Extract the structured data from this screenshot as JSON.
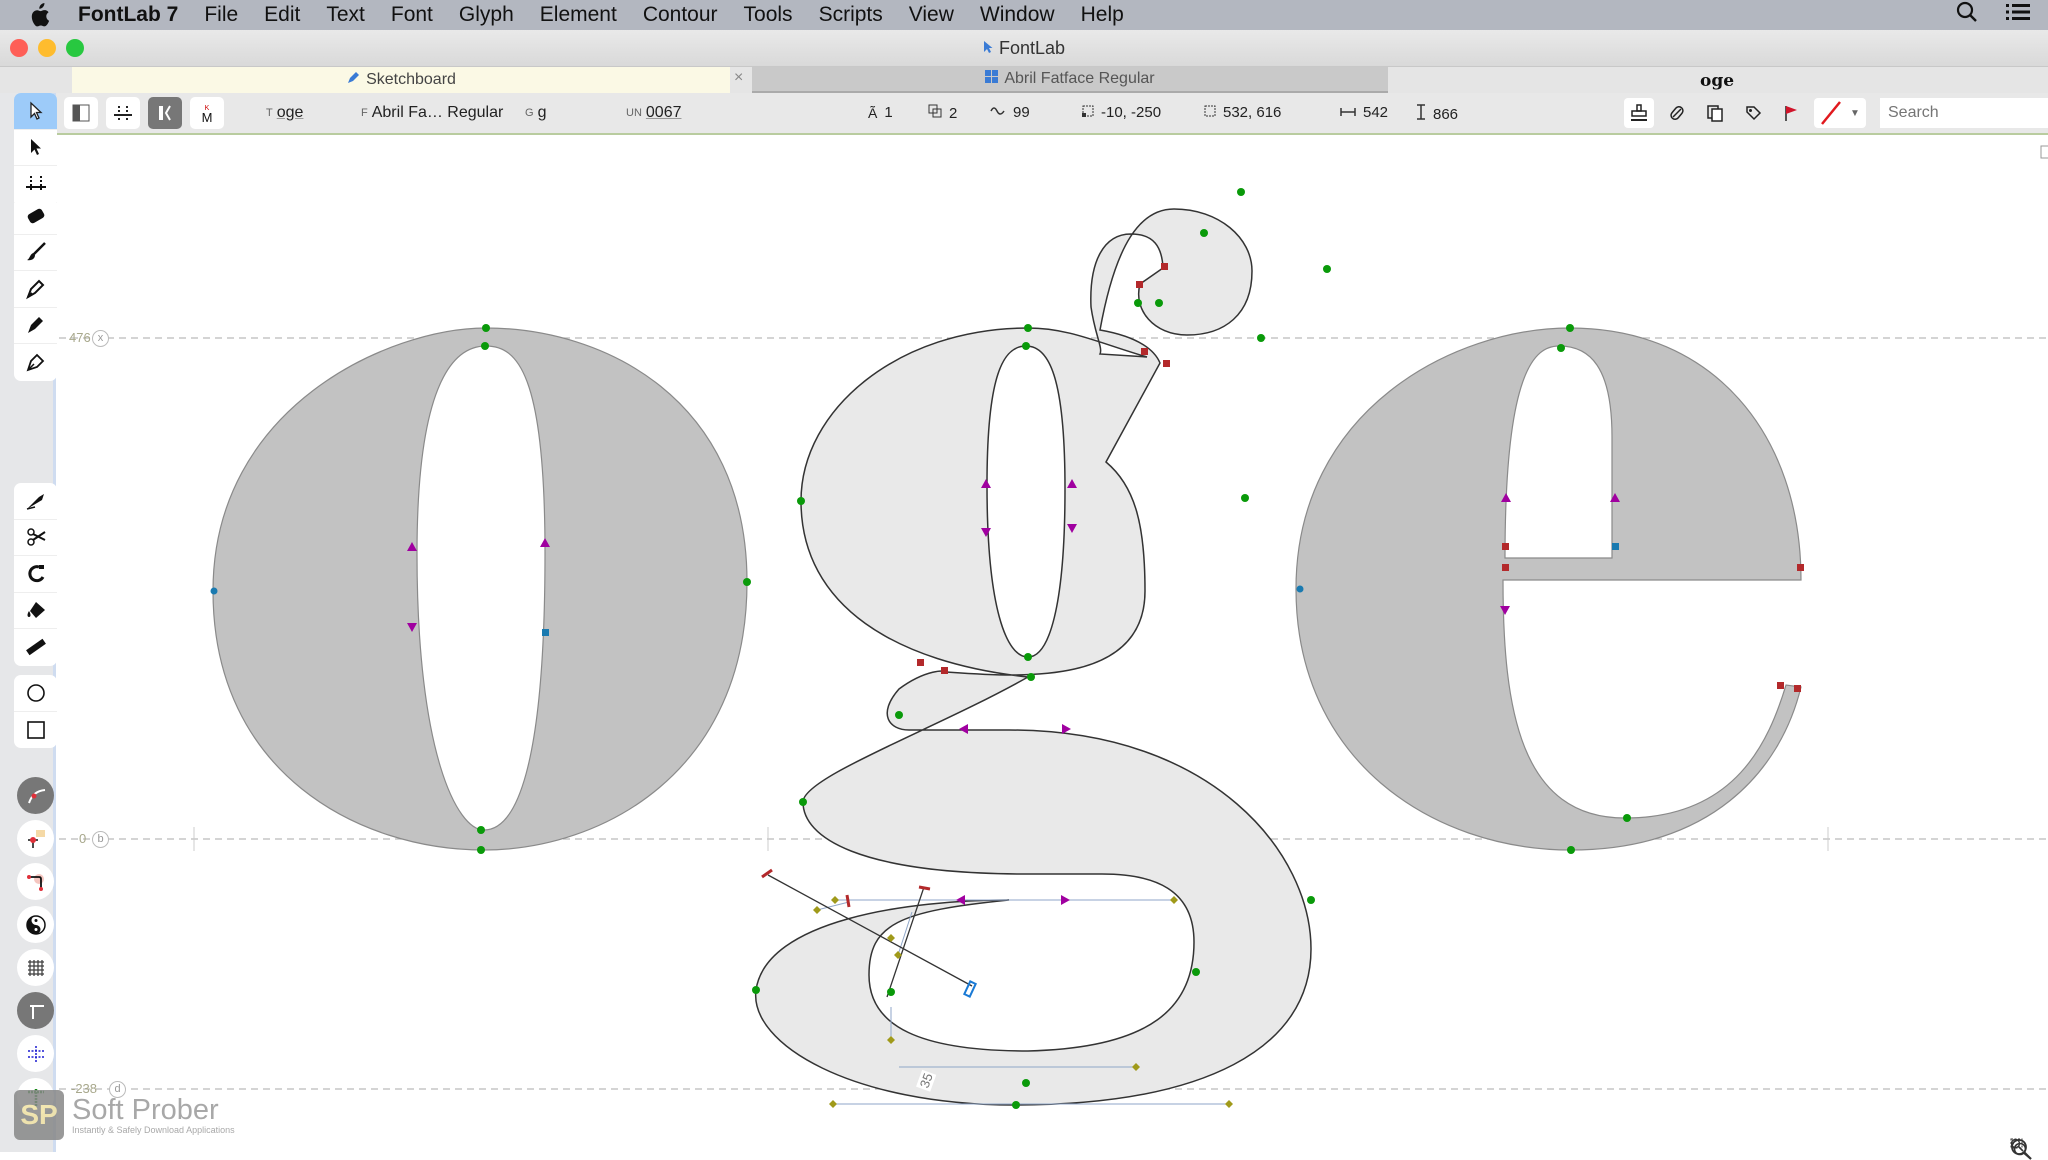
{
  "menubar": {
    "app_name": "FontLab 7",
    "items": [
      "File",
      "Edit",
      "Text",
      "Font",
      "Glyph",
      "Element",
      "Contour",
      "Tools",
      "Scripts",
      "View",
      "Window",
      "Help"
    ],
    "icons": [
      "apple-icon",
      "search-icon",
      "list-icon"
    ]
  },
  "window": {
    "title": "FontLab",
    "traffic_light_colors": {
      "close": "#fe5f57",
      "minimize": "#febc2e",
      "zoom": "#28c840"
    }
  },
  "tabs": {
    "sketchboard": "Sketchboard",
    "close_symbol": "×",
    "font_tab": "Abril Fatface Regular",
    "preview_text": "oge"
  },
  "toolbar": {
    "text_label": "T",
    "text_value": "oge",
    "font_label": "F",
    "font_value": "Abril Fa… Regular",
    "glyph_label": "G",
    "glyph_value": "g",
    "unicode_label": "UN",
    "unicode_value": "0067",
    "layers_count": "1",
    "contours_count": "2",
    "nodes_count": "99",
    "origin": "-10, -250",
    "size": "532, 616",
    "advance_width": "542",
    "height": "866",
    "search_placeholder": "Search"
  },
  "palette": {
    "tools": [
      "contour-tool",
      "element-tool",
      "metrics-tool",
      "kerning-tool",
      "text-tool",
      "eraser-tool",
      "brush-tool",
      "pen-tool",
      "rapidograph-tool",
      "fountain-pen-tool",
      "knife-tool",
      "scissors-tool",
      "magnet-tool",
      "fill-tool",
      "ruler-tool",
      "ellipse-tool",
      "rectangle-tool"
    ],
    "toggles": [
      "curvature-toggle",
      "node-coordinates-toggle",
      "corner-toggle",
      "fill-toggle",
      "grid-toggle",
      "metrics-toggle",
      "guides-toggle",
      "snap-toggle"
    ]
  },
  "canvas": {
    "metric_lines": [
      {
        "name": "x-height",
        "value": "476",
        "badge": "x"
      },
      {
        "name": "baseline",
        "value": "0",
        "badge": "b"
      },
      {
        "name": "descender",
        "value": "-238",
        "badge": "d"
      }
    ],
    "glyphs": [
      "o",
      "g",
      "e"
    ],
    "active_glyph": "g",
    "measurement_label": "35",
    "colors": {
      "glyph_fill_inactive": "#c2c2c2",
      "glyph_fill_active": "#e9e9e9",
      "smooth_node": "#0a9a0a",
      "sharp_node": "#b3292b",
      "start_node": "#1a7ab0",
      "direction_arrow": "#a000a0",
      "handle": "#a09a1a"
    }
  },
  "watermark": {
    "logo": "SP",
    "title": "Soft Prober",
    "subtitle": "Instantly & Safely Download Applications"
  }
}
